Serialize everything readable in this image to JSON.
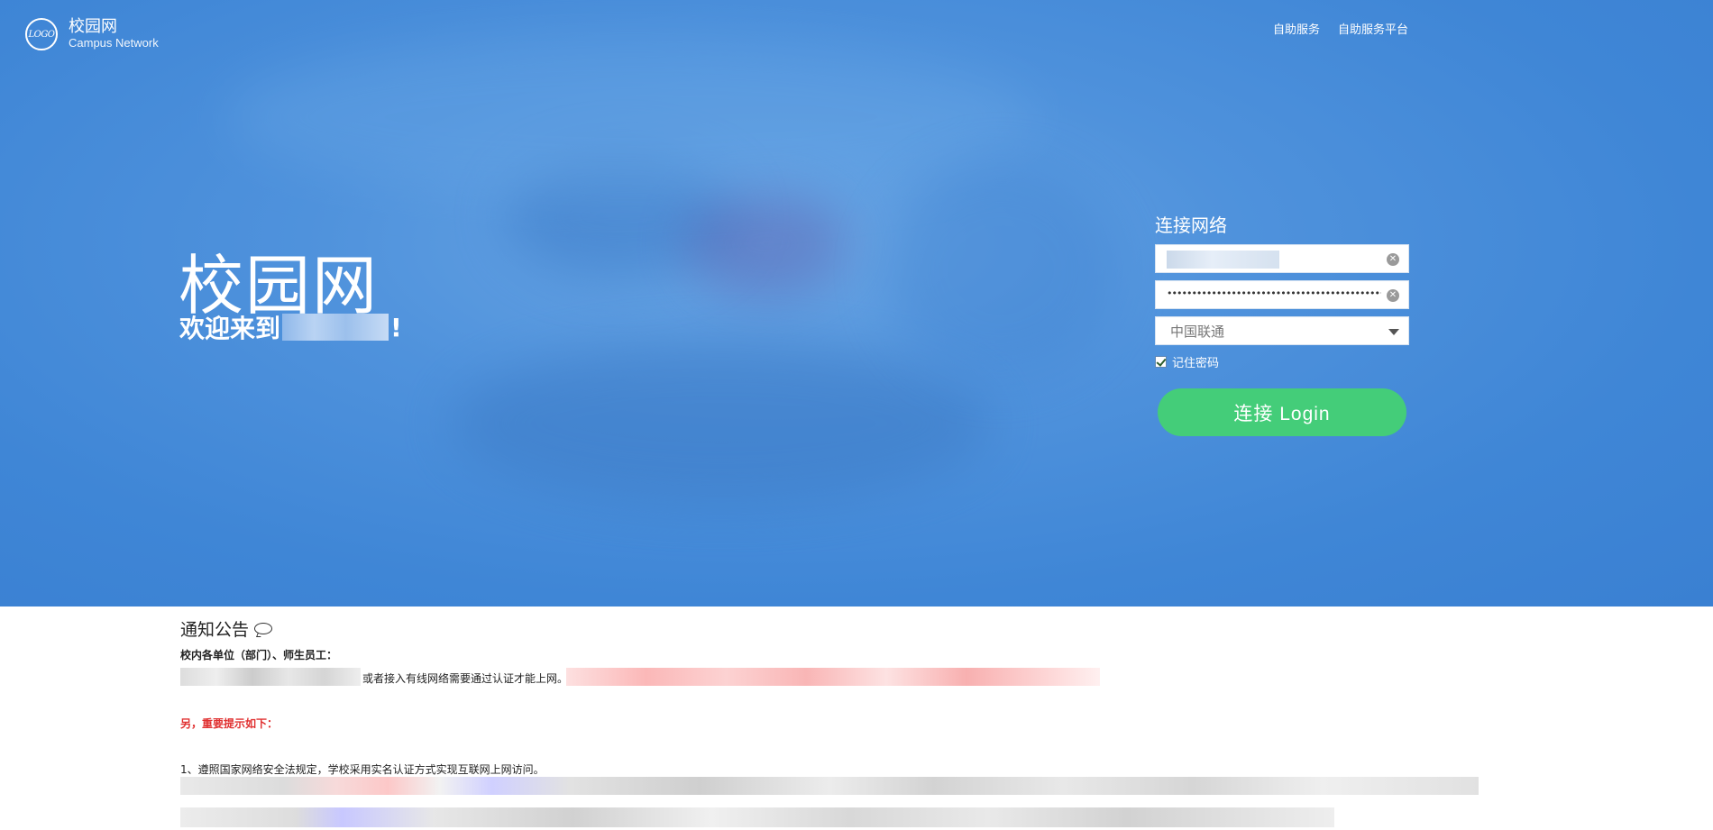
{
  "header": {
    "logo_mark": "LOGO",
    "logo_title": "校园网",
    "logo_subtitle": "Campus Network",
    "nav": [
      {
        "label": "自助服务"
      },
      {
        "label": "自助服务平台"
      }
    ]
  },
  "hero": {
    "title": "校园网",
    "welcome_prefix": "欢迎来到",
    "welcome_suffix": "!"
  },
  "login": {
    "title": "连接网络",
    "password_mask": "••••••••••••••••••••••••••••••••••••••••••••••••••",
    "isp_selected": "中国联通",
    "remember_label": "记住密码",
    "remember_checked": true,
    "button_label": "连接 Login"
  },
  "notice": {
    "heading": "通知公告",
    "greeting": "校内各单位（部门）、师生员工：",
    "line1_visible": "或者接入有线网络需要通过认证才能上网。",
    "important": "另，重要提示如下：",
    "item1": "1、遵照国家网络安全法规定，学校采用实名认证方式实现互联网上网访问。"
  },
  "colors": {
    "hero_blue": "#3f86d6",
    "login_button": "#44cd79",
    "important_text": "#e03030"
  }
}
